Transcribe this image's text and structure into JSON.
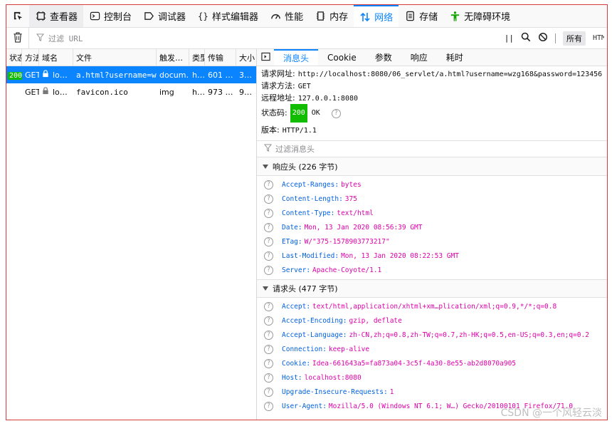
{
  "toolbar": {
    "tabs": [
      {
        "label": "查看器",
        "icon": "inspector-icon"
      },
      {
        "label": "控制台",
        "icon": "console-icon"
      },
      {
        "label": "调试器",
        "icon": "debugger-icon"
      },
      {
        "label": "样式编辑器",
        "icon": "style-editor-icon"
      },
      {
        "label": "性能",
        "icon": "performance-icon"
      },
      {
        "label": "内存",
        "icon": "memory-icon"
      },
      {
        "label": "网络",
        "icon": "network-icon"
      },
      {
        "label": "存储",
        "icon": "storage-icon"
      },
      {
        "label": "无障碍环境",
        "icon": "accessibility-icon"
      }
    ],
    "active_color": "#0a84ff"
  },
  "filterbar": {
    "filter_placeholder": "过滤 URL",
    "separator": "||",
    "all_label": "所有",
    "trunc_label": "HTM"
  },
  "requests": {
    "headers": [
      "状态",
      "方法",
      "域名",
      "文件",
      "触发…",
      "类型",
      "传输",
      "大小"
    ],
    "rows": [
      {
        "status": "200",
        "method": "GET",
        "domain": "lo…",
        "file": "a.html?username=wz…",
        "cause": "docum…",
        "type": "h…",
        "transferred": "601 …",
        "size": "3…"
      },
      {
        "status": "",
        "method": "GET",
        "domain": "lo…",
        "file": "favicon.ico",
        "cause": "img",
        "type": "h…",
        "transferred": "973 …",
        "size": "9…"
      }
    ]
  },
  "details": {
    "tabs": [
      "消息头",
      "Cookie",
      "参数",
      "响应",
      "耗时"
    ],
    "summary": {
      "url_label": "请求网址:",
      "url": "http://localhost:8080/06_servlet/a.html?username=wzg168&password=123456",
      "method_label": "请求方法:",
      "method": "GET",
      "remote_label": "远程地址:",
      "remote": "127.0.0.1:8080",
      "status_label": "状态码:",
      "status_code": "200",
      "status_text": "OK",
      "version_label": "版本:",
      "version": "HTTP/1.1"
    },
    "filter_placeholder": "过滤消息头",
    "response_headers_title": "响应头 (226 字节)",
    "response_headers": [
      {
        "name": "Accept-Ranges:",
        "value": "bytes"
      },
      {
        "name": "Content-Length:",
        "value": "375"
      },
      {
        "name": "Content-Type:",
        "value": "text/html"
      },
      {
        "name": "Date:",
        "value": "Mon, 13 Jan 2020 08:56:39 GMT"
      },
      {
        "name": "ETag:",
        "value": "W/\"375-1578903773217\""
      },
      {
        "name": "Last-Modified:",
        "value": "Mon, 13 Jan 2020 08:22:53 GMT"
      },
      {
        "name": "Server:",
        "value": "Apache-Coyote/1.1"
      }
    ],
    "request_headers_title": "请求头 (477 字节)",
    "request_headers": [
      {
        "name": "Accept:",
        "value": "text/html,application/xhtml+xm…plication/xml;q=0.9,*/*;q=0.8"
      },
      {
        "name": "Accept-Encoding:",
        "value": "gzip, deflate"
      },
      {
        "name": "Accept-Language:",
        "value": "zh-CN,zh;q=0.8,zh-TW;q=0.7,zh-HK;q=0.5,en-US;q=0.3,en;q=0.2"
      },
      {
        "name": "Connection:",
        "value": "keep-alive"
      },
      {
        "name": "Cookie:",
        "value": "Idea-661643a5=fa873a04-3c5f-4a30-8e55-ab2d8070a905"
      },
      {
        "name": "Host:",
        "value": "localhost:8080"
      },
      {
        "name": "Upgrade-Insecure-Requests:",
        "value": "1"
      },
      {
        "name": "User-Agent:",
        "value": "Mozilla/5.0 (Windows NT 6.1; W…) Gecko/20100101 Firefox/71.0"
      }
    ]
  },
  "watermark": "CSDN @一个风轻云淡"
}
